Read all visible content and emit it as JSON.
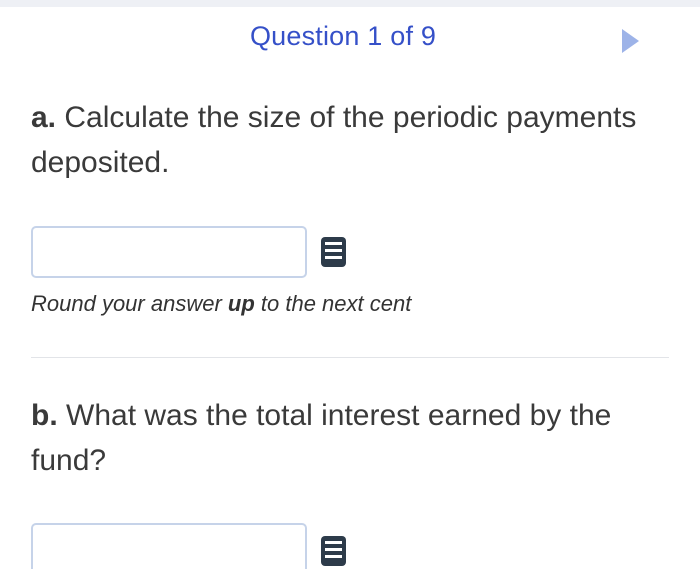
{
  "header": {
    "question_counter": "Question 1 of 9",
    "next_icon": "play-arrow-icon"
  },
  "part_a": {
    "label": "a.",
    "text": " Calculate the size of the periodic payments deposited.",
    "input_value": "",
    "calculator_icon": "calculator-icon",
    "hint_before": "Round your answer ",
    "hint_emph": "up",
    "hint_after": " to the next cent"
  },
  "part_b": {
    "label": "b.",
    "text": " What was the total interest earned by the fund?",
    "input_value": "",
    "calculator_icon": "calculator-icon"
  },
  "colors": {
    "accent": "#3550c8",
    "arrow": "#9db3e8",
    "input_border": "#c6d3e9",
    "icon": "#2d3b4a"
  }
}
